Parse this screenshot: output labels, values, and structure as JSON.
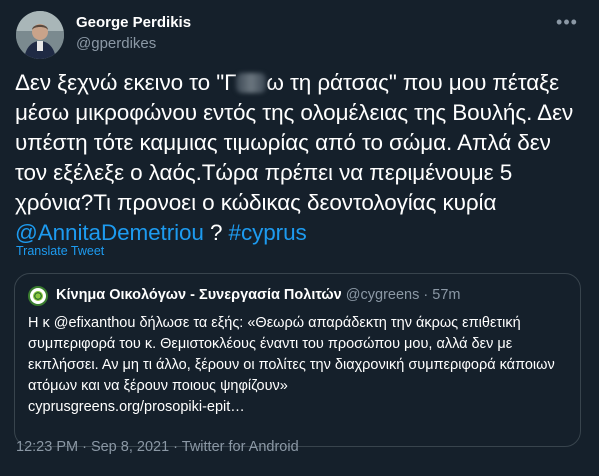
{
  "author": {
    "name": "George Perdikis",
    "handle": "@gperdikes"
  },
  "tweet": {
    "text_part1": "Δεν ξεχνώ εκεινο το \"Γ",
    "text_part2": "ω τη ράτσας\" που μου πέταξε μέσω μικροφώνου εντός της ολομέλειας της Βουλής. Δεν υπέστη τότε καμμιας τιμωρίας από το σώμα. Απλά δεν τον εξέλεξε ο λαός.Τώρα πρέπει να περιμένουμε 5 χρόνια?Τι προνοει ο κώδικας δεοντολογίας κυρία ",
    "mention": "@AnnitaDemetriou",
    "between": " ? ",
    "hashtag": "#cyprus"
  },
  "translate_label": "Translate Tweet",
  "quoted": {
    "name": "Κίνημα Οικολόγων - Συνεργασία Πολιτών",
    "handle": "@cygreens",
    "separator": "·",
    "time": "57m",
    "text": "Η κ @efixanthou δήλωσε τα εξής: «Θεωρώ απαράδεκτη την άκρως επιθετική συμπεριφορά του κ. Θεμιστοκλέους έναντι του προσώπου μου, αλλά δεν με εκπλήσσει. Αν μη τι άλλο, ξέρουν οι πολίτες την διαχρονική συμπεριφορά κάποιων ατόμων και να ξέρουν ποιους ψηφίζουν»",
    "link": "cyprusgreens.org/prosopiki-epit…"
  },
  "timestamp": "12:23 PM · Sep 8, 2021 · Twitter for Android",
  "icons": {
    "more": "more-options-icon",
    "quoted_avatar": "cygreens-logo-icon"
  },
  "colors": {
    "background": "#15202b",
    "link": "#1d9bf0",
    "muted": "#8b98a5",
    "border": "#38444d"
  }
}
